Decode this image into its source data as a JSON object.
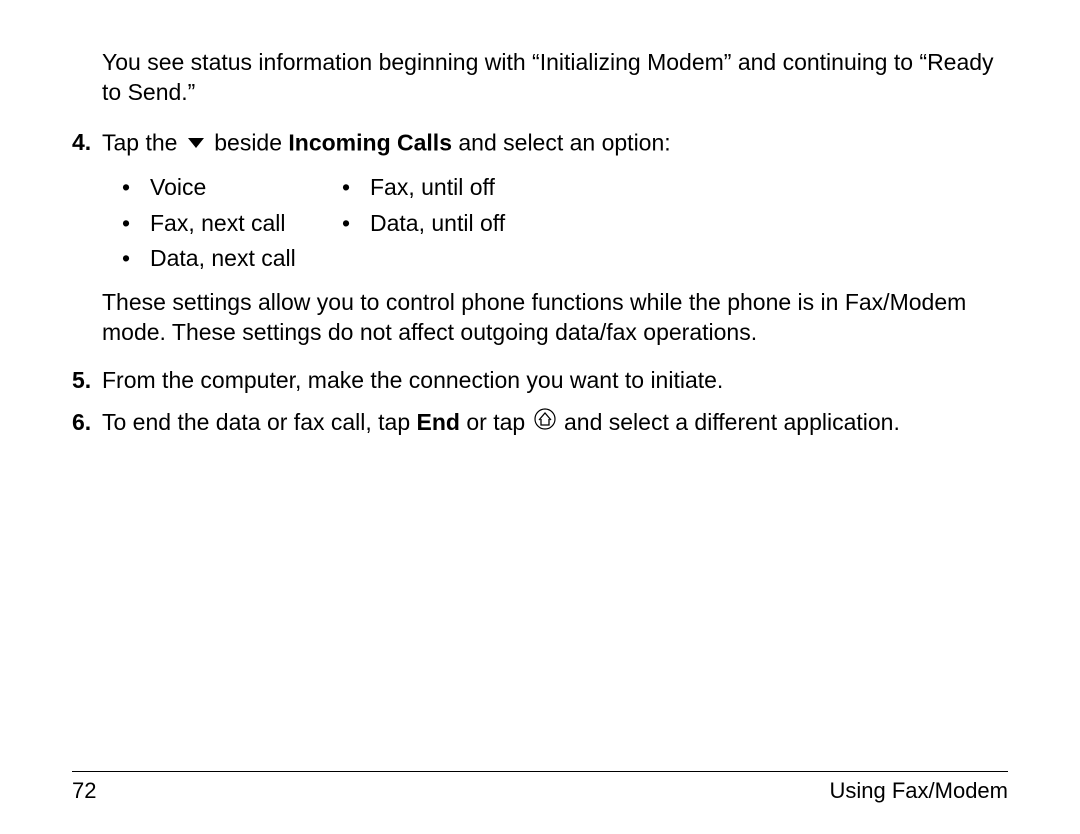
{
  "intro": "You see status information beginning with “Initializing Modem” and continuing to “Ready to Send.”",
  "steps": {
    "s4": {
      "num": "4.",
      "prefix": "Tap the ",
      "middle": " beside ",
      "bold_label": "Incoming Calls",
      "suffix": " and select an option:"
    },
    "s5": {
      "num": "5.",
      "text": "From the computer, make the connection you want to initiate."
    },
    "s6": {
      "num": "6.",
      "prefix": "To end the data or fax call, tap ",
      "end_label": "End",
      "middle": " or tap ",
      "suffix": " and select a different application."
    }
  },
  "options": {
    "o1": "Voice",
    "o2": "Fax, until off",
    "o3": "Fax, next call",
    "o4": "Data, until off",
    "o5": "Data, next call"
  },
  "settings_note": "These settings allow you to control phone functions while the phone is in Fax/Modem mode. These settings do not affect outgoing data/fax operations.",
  "footer": {
    "page_num": "72",
    "section": "Using Fax/Modem"
  }
}
